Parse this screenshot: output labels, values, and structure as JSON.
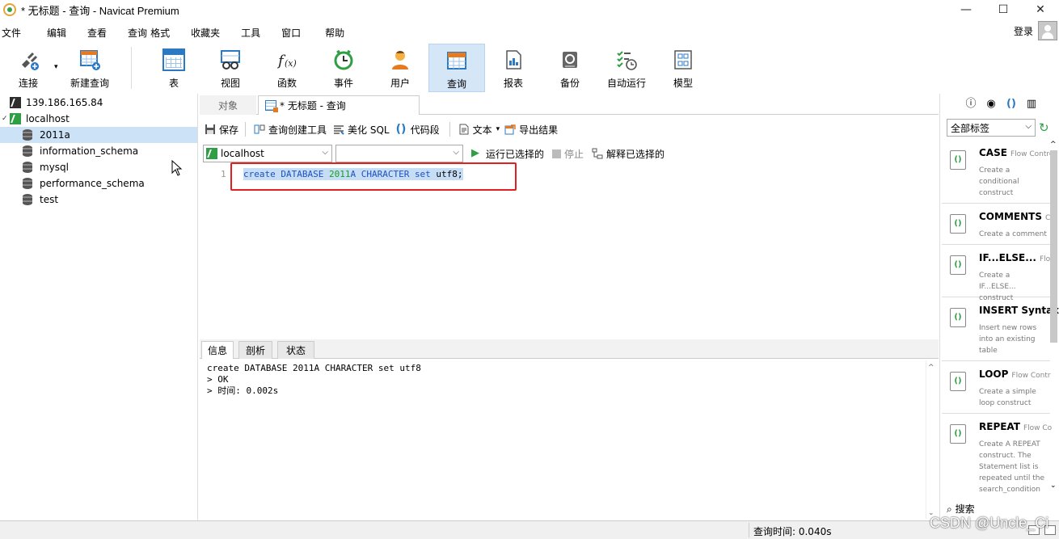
{
  "window": {
    "title": "* 无标题 - 查询 - Navicat Premium",
    "minimize": "—",
    "maximize": "☐",
    "close": "✕"
  },
  "menu": [
    "文件",
    "编辑",
    "查看",
    "查询",
    "格式",
    "收藏夹",
    "工具",
    "窗口",
    "帮助"
  ],
  "login": "登录",
  "toolbar": {
    "connect": "连接",
    "new_query": "新建查询",
    "table": "表",
    "view": "视图",
    "function": "函数",
    "event": "事件",
    "user": "用户",
    "query": "查询",
    "report": "报表",
    "backup": "备份",
    "autorun": "自动运行",
    "model": "模型"
  },
  "tree": {
    "server1": "139.186.165.84",
    "server2": "localhost",
    "databases": [
      "2011a",
      "information_schema",
      "mysql",
      "performance_schema",
      "test"
    ]
  },
  "tabs": {
    "objects": "对象",
    "query_tab": "* 无标题 - 查询"
  },
  "query_toolbar": {
    "save": "保存",
    "builder": "查询创建工具",
    "beautify": "美化 SQL",
    "snippet": "代码段",
    "text": "文本",
    "export": "导出结果"
  },
  "run_bar": {
    "connection": "localhost",
    "database": "",
    "run_selected": "运行已选择的",
    "stop": "停止",
    "explain": "解释已选择的"
  },
  "editor": {
    "line_number": "1",
    "code_kw1": "create DATABASE ",
    "code_num": "2011",
    "code_rest": "A CHARACTER set",
    "code_tail": " utf8;"
  },
  "bottom_tabs": [
    "信息",
    "剖析",
    "状态"
  ],
  "messages": "create DATABASE 2011A CHARACTER set utf8\n> OK\n> 时间: 0.002s",
  "right_panel": {
    "tag_select": "全部标签",
    "snippets": [
      {
        "title": "CASE",
        "category": "Flow Contro",
        "desc": "Create a conditional construct"
      },
      {
        "title": "COMMENTS",
        "category": "C",
        "desc": "Create a comment"
      },
      {
        "title": "IF...ELSE...",
        "category": "Flow",
        "desc": "Create a IF...ELSE... construct"
      },
      {
        "title": "INSERT Syntax",
        "category": "",
        "desc": "Insert new rows into an existing table"
      },
      {
        "title": "LOOP",
        "category": "Flow Contr",
        "desc": "Create a simple loop construct"
      },
      {
        "title": "REPEAT",
        "category": "Flow Co",
        "desc": "Create A REPEAT construct. The Statement list is repeated until the search_condition"
      }
    ],
    "search": "搜索"
  },
  "status": {
    "query_time": "查询时间: 0.040s"
  },
  "watermark": "CSDN @Uncle_Ci"
}
